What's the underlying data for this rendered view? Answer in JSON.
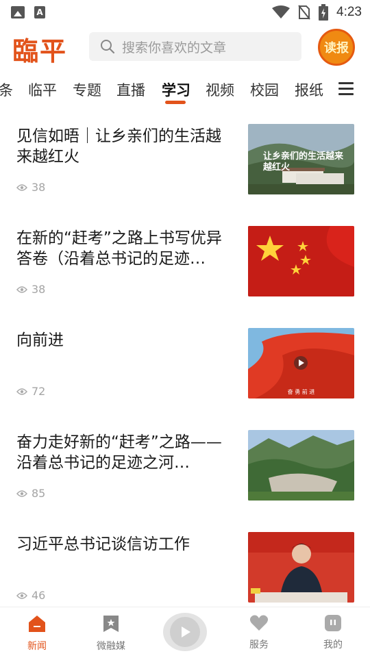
{
  "status_bar": {
    "time": "4:23"
  },
  "header": {
    "logo": "臨平",
    "search_placeholder": "搜索你喜欢的文章",
    "read_badge": "读报"
  },
  "tabs": {
    "items": [
      "条",
      "临平",
      "专题",
      "直播",
      "学习",
      "视频",
      "校园",
      "报纸"
    ],
    "active": "学习"
  },
  "articles": [
    {
      "title": "见信如晤｜让乡亲们的生活越来越红火",
      "views": "38",
      "thumb_caption": "让乡亲们的生活越来越红火"
    },
    {
      "title": "在新的“赶考”之路上书写优异答卷（沿着总书记的足迹…",
      "views": "38"
    },
    {
      "title": "向前进",
      "views": "72",
      "thumb_caption": "奋 勇 前 进"
    },
    {
      "title": "奋力走好新的“赶考”之路——沿着总书记的足迹之河…",
      "views": "85"
    },
    {
      "title": "习近平总书记谈信访工作",
      "views": "46"
    }
  ],
  "bottom_nav": {
    "items": [
      "新闻",
      "微融媒",
      "服务",
      "我的"
    ],
    "active": "新闻"
  },
  "colors": {
    "accent": "#e2531b"
  }
}
